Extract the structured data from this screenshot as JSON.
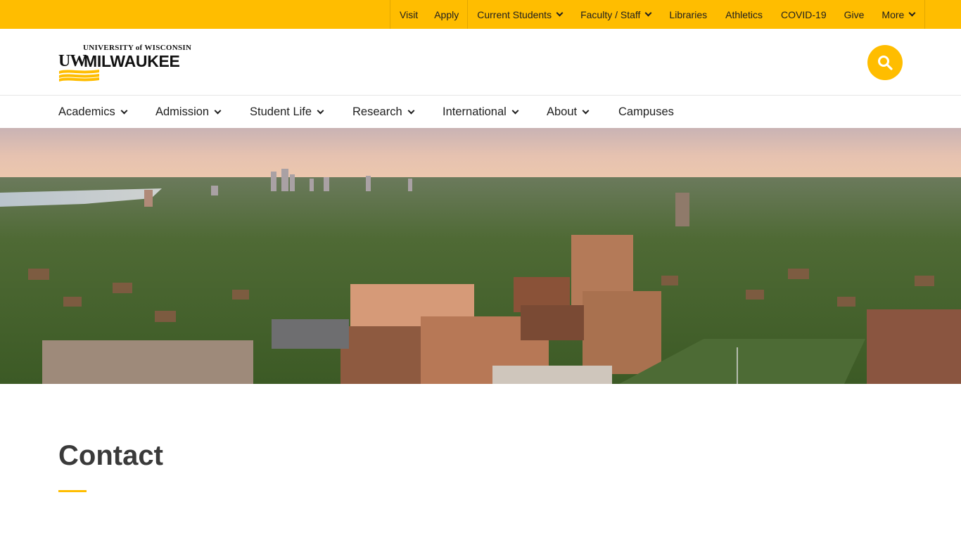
{
  "utility_nav": {
    "items": [
      {
        "label": "Visit",
        "dropdown": false
      },
      {
        "label": "Apply",
        "dropdown": false
      },
      {
        "label": "Current Students",
        "dropdown": true
      },
      {
        "label": "Faculty / Staff",
        "dropdown": true
      },
      {
        "label": "Libraries",
        "dropdown": false
      },
      {
        "label": "Athletics",
        "dropdown": false
      },
      {
        "label": "COVID-19",
        "dropdown": false
      },
      {
        "label": "Give",
        "dropdown": false
      },
      {
        "label": "More",
        "dropdown": true
      }
    ]
  },
  "logo": {
    "top_text": "UNIVERSITY of WISCONSIN",
    "uw_text": "UW",
    "main_text": "MILWAUKEE"
  },
  "search": {
    "icon": "search-icon"
  },
  "main_nav": {
    "items": [
      {
        "label": "Academics",
        "dropdown": true
      },
      {
        "label": "Admission",
        "dropdown": true
      },
      {
        "label": "Student Life",
        "dropdown": true
      },
      {
        "label": "Research",
        "dropdown": true
      },
      {
        "label": "International",
        "dropdown": true
      },
      {
        "label": "About",
        "dropdown": true
      },
      {
        "label": "Campuses",
        "dropdown": false
      }
    ]
  },
  "page": {
    "title": "Contact"
  },
  "colors": {
    "brand_gold": "#ffbd00",
    "text_dark": "#1f1f1f",
    "title": "#3a3a3a"
  }
}
